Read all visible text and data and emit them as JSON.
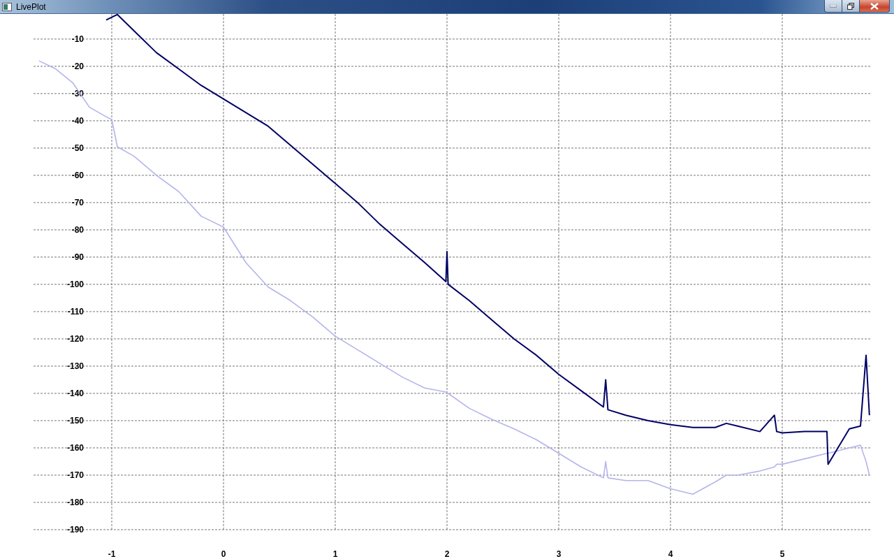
{
  "window": {
    "title": "LivePlot"
  },
  "plot": {
    "chart_data": {
      "type": "line",
      "x": [
        -1.65,
        -1.5,
        -1.35,
        -1.2,
        -1.05,
        -1.0,
        -0.95,
        -0.8,
        -0.6,
        -0.4,
        -0.2,
        0,
        0.2,
        0.4,
        0.6,
        0.8,
        1,
        1.2,
        1.4,
        1.6,
        1.8,
        1.99,
        2.0,
        2.01,
        2.2,
        2.4,
        2.6,
        2.8,
        3,
        3.2,
        3.4,
        3.42,
        3.44,
        3.6,
        3.8,
        4,
        4.2,
        4.4,
        4.5,
        4.6,
        4.8,
        4.93,
        4.95,
        5,
        5.2,
        5.4,
        5.41,
        5.6,
        5.7,
        5.75,
        5.78
      ],
      "series": [
        {
          "color": "#000066",
          "values": [
            null,
            null,
            null,
            null,
            -3,
            -2,
            -1,
            -7,
            -15,
            -21,
            -27,
            -32,
            -37,
            -42,
            -49,
            -56,
            -63,
            -70,
            -78,
            -85,
            -92,
            -99,
            -88,
            -100,
            -106,
            -113,
            -120,
            -126,
            -133,
            -139,
            -145,
            -135,
            -146,
            -148,
            -150,
            -151.5,
            -152.5,
            -152.5,
            -151,
            -152,
            -154,
            -148,
            -154,
            -154.5,
            -154,
            -154,
            -166,
            -153,
            -152,
            -126,
            -148
          ]
        },
        {
          "color": "#b4b4ec",
          "values": [
            -18,
            -21,
            -26,
            -35,
            -38.5,
            -39.5,
            -49.5,
            -53,
            -60,
            -66,
            -75,
            -79,
            -92,
            -101,
            -106,
            -112,
            -119,
            -124,
            -129,
            -134,
            -138,
            -139.5,
            -140,
            -140,
            -145.5,
            -149.5,
            -153,
            -157,
            -162,
            -167,
            -171,
            -165,
            -171,
            -172,
            -172,
            -175,
            -177,
            -172.5,
            -170,
            -170,
            -168.5,
            -167,
            -166,
            -166,
            -164,
            -162,
            -162,
            -160,
            -159,
            -165,
            -170
          ]
        }
      ],
      "grid": true,
      "xlim": [
        -1.7,
        5.8
      ],
      "ylim": [
        -190,
        -0.8
      ],
      "xticks": [
        -1,
        0,
        1,
        2,
        3,
        4,
        5
      ],
      "yticks": [
        -10,
        -20,
        -30,
        -40,
        -50,
        -60,
        -70,
        -80,
        -90,
        -100,
        -110,
        -120,
        -130,
        -140,
        -150,
        -160,
        -170,
        -180,
        -190
      ]
    }
  }
}
